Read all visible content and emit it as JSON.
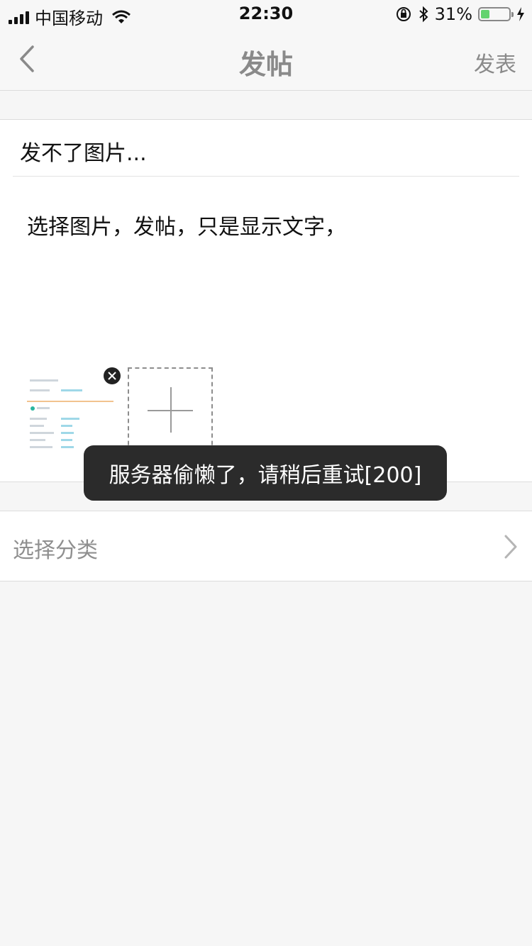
{
  "status_bar": {
    "carrier": "中国移动",
    "time": "22:30",
    "battery": "31%",
    "battery_level": 0.31
  },
  "nav": {
    "title": "发帖",
    "publish_label": "发表"
  },
  "post": {
    "title": "发不了图片...",
    "body": "选择图片，发帖，只是显示文字，"
  },
  "category": {
    "label": "选择分类"
  },
  "toast": {
    "message": "服务器偷懒了，请稍后重试[200]"
  },
  "colors": {
    "accent_gray": "#8a8a8a",
    "toast_bg": "#2b2b2b",
    "battery_green": "#62d36e"
  },
  "icons": [
    "signal-icon",
    "wifi-icon",
    "lock-rotation-icon",
    "bluetooth-icon",
    "battery-icon",
    "charging-icon",
    "back-icon",
    "remove-icon",
    "add-image-icon",
    "chevron-right-icon"
  ]
}
